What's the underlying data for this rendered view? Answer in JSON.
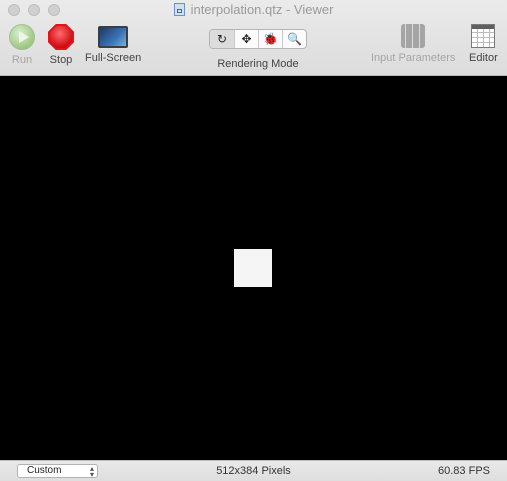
{
  "window": {
    "title": "interpolation.qtz - Viewer"
  },
  "toolbar": {
    "run_label": "Run",
    "stop_label": "Stop",
    "fullscreen_label": "Full-Screen",
    "rendering_mode_label": "Rendering Mode",
    "rendering_mode_icons": [
      "↻",
      "✥",
      "🐞",
      "🔍"
    ],
    "input_parameters_label": "Input Parameters",
    "editor_label": "Editor"
  },
  "statusbar": {
    "size_popup_value": "Custom",
    "resolution": "512x384 Pixels",
    "fps": "60.83 FPS"
  },
  "colors": {
    "canvas": "#000000",
    "square": "#f5f5f5",
    "stop": "#e0141b",
    "run": "#86bf65"
  }
}
